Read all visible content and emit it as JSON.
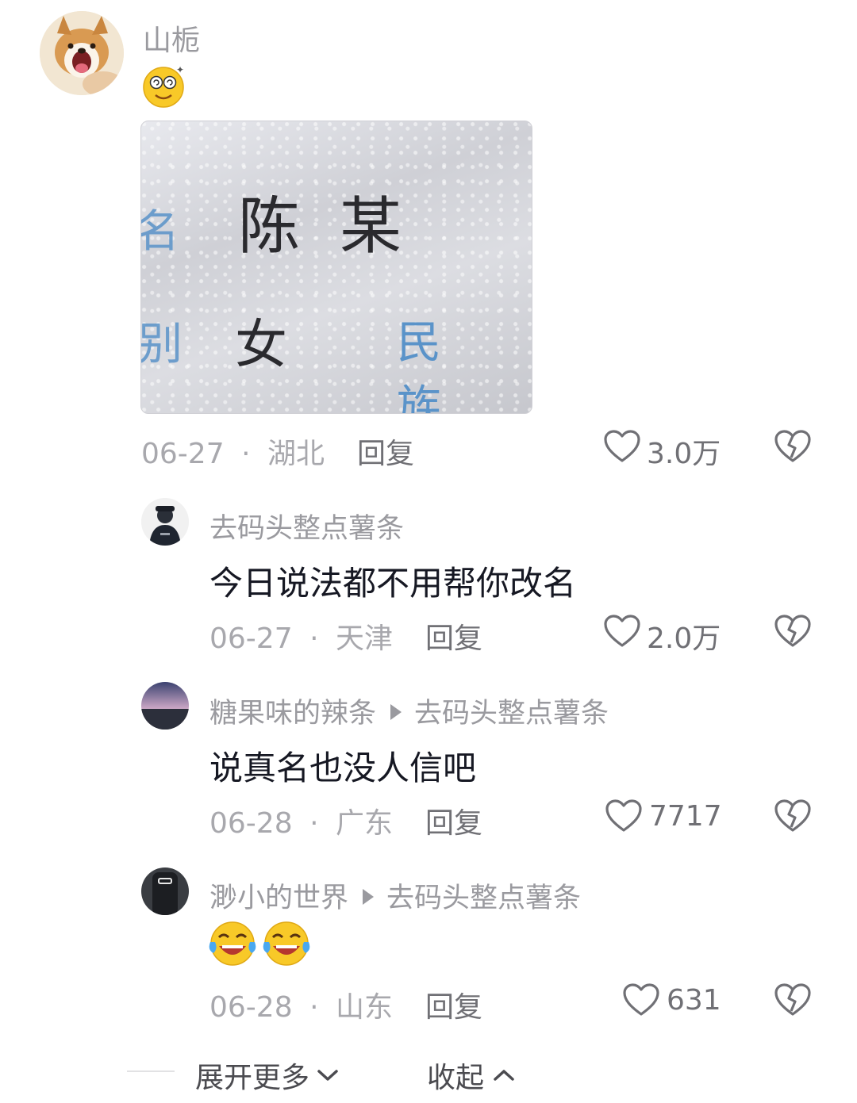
{
  "comments": [
    {
      "username": "山栀",
      "date": "06-27",
      "separator": "·",
      "location": "湖北",
      "reply_label": "回复",
      "like_count": "3.0万",
      "image_card": {
        "name_label": "名",
        "name_value": "陈某",
        "gender_label": "别",
        "gender_value": "女",
        "ethnicity_label": "民族"
      }
    },
    {
      "username": "去码头整点薯条",
      "text": "今日说法都不用帮你改名",
      "date": "06-27",
      "separator": "·",
      "location": "天津",
      "reply_label": "回复",
      "like_count": "2.0万"
    },
    {
      "username": "糖果味的辣条",
      "reply_to": "去码头整点薯条",
      "text": "说真名也没人信吧",
      "date": "06-28",
      "separator": "·",
      "location": "广东",
      "reply_label": "回复",
      "like_count": "7717"
    },
    {
      "username": "渺小的世界",
      "reply_to": "去码头整点薯条",
      "date": "06-28",
      "separator": "·",
      "location": "山东",
      "reply_label": "回复",
      "like_count": "631"
    }
  ],
  "footer": {
    "expand_more": "展开更多",
    "collapse": "收起"
  },
  "icons": {
    "like": "heart-outline-icon",
    "dislike": "broken-heart-icon",
    "chevron_down": "chevron-down-icon",
    "chevron_up": "chevron-up-icon"
  }
}
